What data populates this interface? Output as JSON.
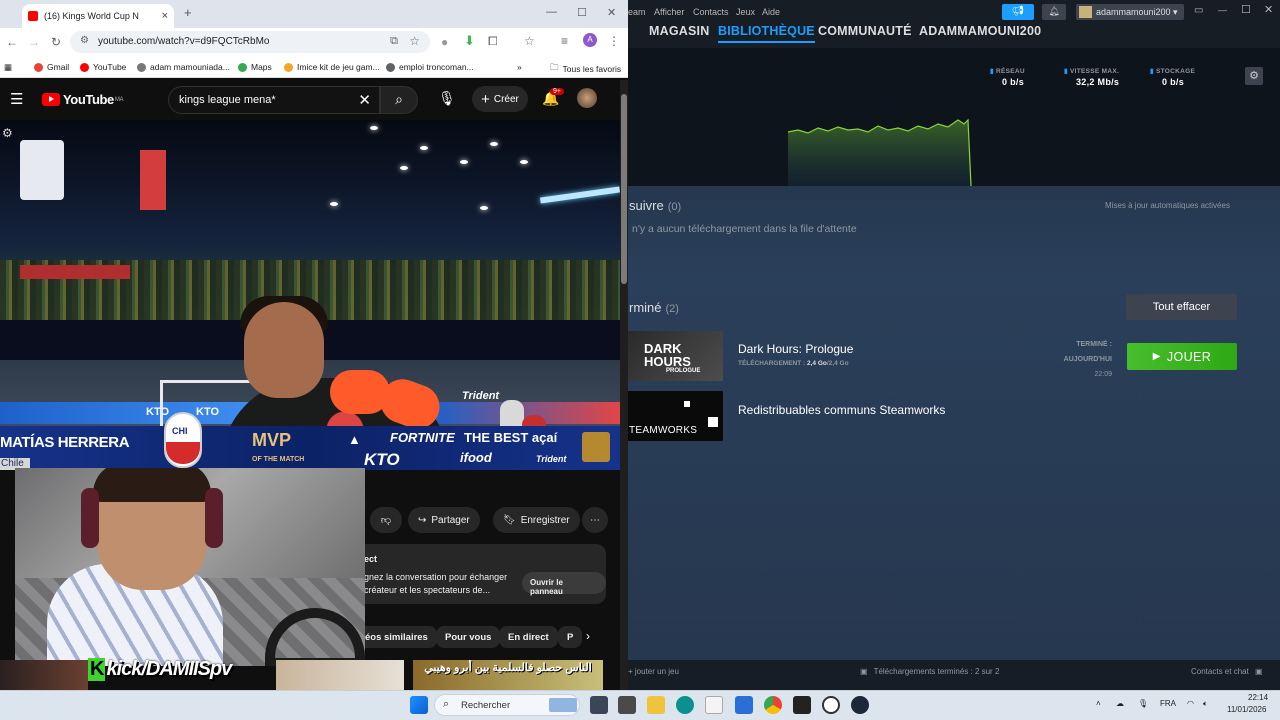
{
  "chrome": {
    "tab_count_title": "(16)",
    "tab_title": "Kings World Cup N",
    "url": "youtube.com/watch?v=d9FQCTcRbMo",
    "bookmarks": [
      "Gmail",
      "YouTube",
      "adam mamouniada...",
      "Maps",
      "Imice kit de jeu gam...",
      "emploi troncoman..."
    ],
    "all_bookmarks": "Tous les favoris"
  },
  "youtube": {
    "logo": "YouTube",
    "logo_region": "MA",
    "search_query": "kings league mena*",
    "create_label": "Créer",
    "notif_count": "9+",
    "overlay": {
      "player_name": "MATÍAS HERRERA",
      "country": "Chile",
      "team": "CHI",
      "mvp": "MVP",
      "mvp_sub": "OF THE MATCH",
      "sponsor1": "FORTNITE",
      "sponsor2": "KTO",
      "sponsor3": "THE BEST açaí",
      "sponsor4": "ifood",
      "sponsor5": "Trident",
      "board_text1": "KTO",
      "board_text2": "Trident"
    },
    "actions": {
      "share": "Partager",
      "save": "Enregistrer"
    },
    "chat": {
      "title": "ect",
      "line1": "gnez la conversation pour échanger",
      "line2": "créateur et les spectateurs de...",
      "open_panel": "Ouvrir le panneau"
    },
    "chips": [
      "éos similaires",
      "Pour vous",
      "En direct",
      "P"
    ],
    "streamer_tag": "kick/DAMIISpv",
    "thumb_text": "الناس حصلو فالسلمية بين أبرو وهيبي"
  },
  "steam": {
    "menu": [
      "eam",
      "Afficher",
      "Contacts",
      "Jeux",
      "Aide"
    ],
    "username": "adammamouni200",
    "nav": [
      "MAGASIN",
      "BIBLIOTHÈQUE",
      "COMMUNAUTÉ",
      "ADAMMAMOUNI200"
    ],
    "stats": [
      {
        "label": "RÉSEAU",
        "value": "0 b/s"
      },
      {
        "label": "VITESSE MAX.",
        "value": "32,2 Mb/s"
      },
      {
        "label": "STOCKAGE",
        "value": "0 b/s"
      }
    ],
    "queue": {
      "title": "suivre",
      "count": "(0)",
      "empty": "n'y a aucun téléchargement dans la file d'attente",
      "auto_updates": "Mises à jour automatiques activées"
    },
    "done": {
      "title": "rminé",
      "count": "(2)",
      "clear_all": "Tout effacer"
    },
    "games": [
      {
        "name": "Dark Hours: Prologue",
        "thumb_line1": "DARK",
        "thumb_line2": "HOURS",
        "thumb_line3": "PROLOGUE",
        "detail_label": "TÉLÉCHARGEMENT",
        "size_done": "2,4 Go",
        "size_total": "/2,4 Go",
        "status_line1": "TERMINÉ :",
        "status_line2": "AUJOURD'HUI",
        "status_time": "22:09",
        "play_label": "JOUER"
      },
      {
        "name": "Redistribuables communs Steamworks",
        "thumb_text": "TEAMWORKS"
      }
    ],
    "footer": {
      "add_game": "jouter un jeu",
      "downloads": "Téléchargements terminés : 2 sur 2",
      "friends": "Contacts et chat"
    },
    "colors": {
      "accent": "#1a9fff",
      "play": "#47bf2c"
    }
  },
  "taskbar": {
    "search": "Rechercher",
    "lang": "FRA",
    "time": "22:14",
    "date": "11/01/2026"
  }
}
